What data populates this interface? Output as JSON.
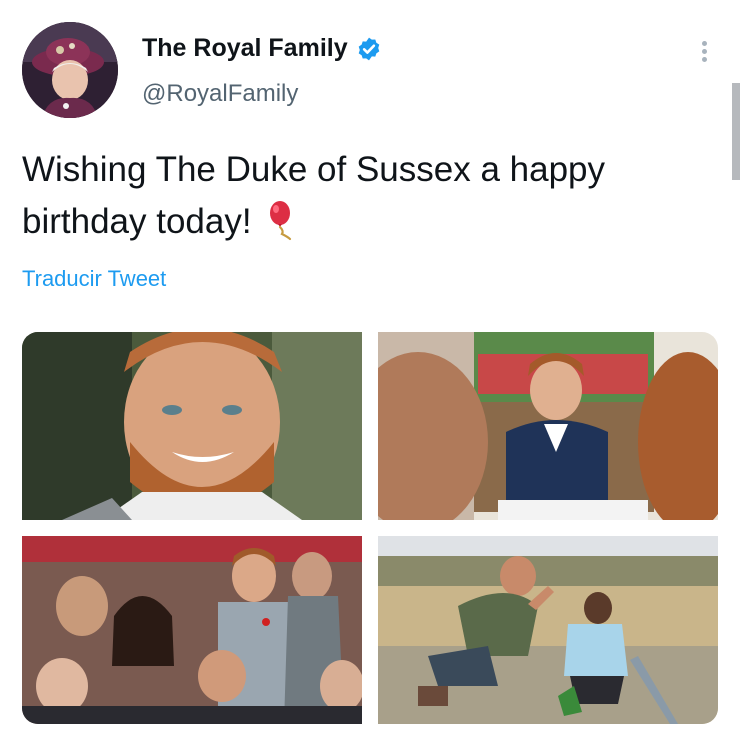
{
  "author": {
    "name": "The Royal Family",
    "handle": "@RoyalFamily",
    "verified": true,
    "avatar_icon": "avatar-queen-portrait"
  },
  "tweet": {
    "text": "Wishing The Duke of Sussex a happy birthday today!",
    "emoji_icon": "balloon-icon",
    "translate_label": "Traducir Tweet"
  },
  "colors": {
    "link": "#1d9bf0",
    "verified_badge": "#1d9bf0",
    "text_primary": "#0f1419",
    "text_secondary": "#536471"
  },
  "media": {
    "count": 4,
    "items": [
      {
        "icon": "photo-harry-closeup-smiling"
      },
      {
        "icon": "photo-harry-at-table-classroom"
      },
      {
        "icon": "photo-harry-meghan-in-crowd"
      },
      {
        "icon": "photo-harry-high-five-child"
      }
    ]
  }
}
